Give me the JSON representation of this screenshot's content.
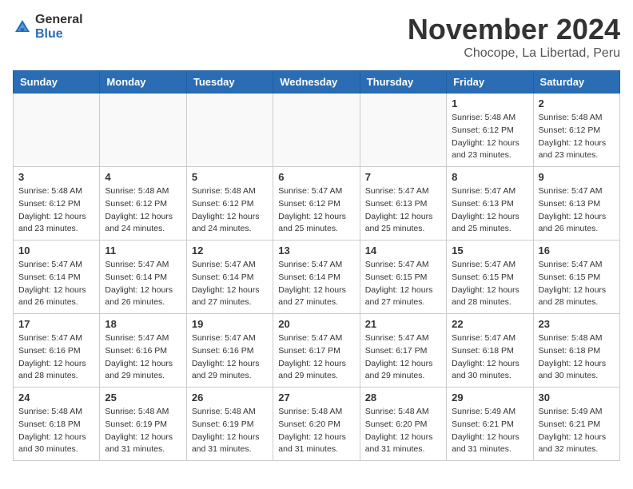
{
  "header": {
    "logo_general": "General",
    "logo_blue": "Blue",
    "title": "November 2024",
    "location": "Chocope, La Libertad, Peru"
  },
  "weekdays": [
    "Sunday",
    "Monday",
    "Tuesday",
    "Wednesday",
    "Thursday",
    "Friday",
    "Saturday"
  ],
  "weeks": [
    [
      {
        "day": "",
        "info": ""
      },
      {
        "day": "",
        "info": ""
      },
      {
        "day": "",
        "info": ""
      },
      {
        "day": "",
        "info": ""
      },
      {
        "day": "",
        "info": ""
      },
      {
        "day": "1",
        "info": "Sunrise: 5:48 AM\nSunset: 6:12 PM\nDaylight: 12 hours and 23 minutes."
      },
      {
        "day": "2",
        "info": "Sunrise: 5:48 AM\nSunset: 6:12 PM\nDaylight: 12 hours and 23 minutes."
      }
    ],
    [
      {
        "day": "3",
        "info": "Sunrise: 5:48 AM\nSunset: 6:12 PM\nDaylight: 12 hours and 23 minutes."
      },
      {
        "day": "4",
        "info": "Sunrise: 5:48 AM\nSunset: 6:12 PM\nDaylight: 12 hours and 24 minutes."
      },
      {
        "day": "5",
        "info": "Sunrise: 5:48 AM\nSunset: 6:12 PM\nDaylight: 12 hours and 24 minutes."
      },
      {
        "day": "6",
        "info": "Sunrise: 5:47 AM\nSunset: 6:12 PM\nDaylight: 12 hours and 25 minutes."
      },
      {
        "day": "7",
        "info": "Sunrise: 5:47 AM\nSunset: 6:13 PM\nDaylight: 12 hours and 25 minutes."
      },
      {
        "day": "8",
        "info": "Sunrise: 5:47 AM\nSunset: 6:13 PM\nDaylight: 12 hours and 25 minutes."
      },
      {
        "day": "9",
        "info": "Sunrise: 5:47 AM\nSunset: 6:13 PM\nDaylight: 12 hours and 26 minutes."
      }
    ],
    [
      {
        "day": "10",
        "info": "Sunrise: 5:47 AM\nSunset: 6:14 PM\nDaylight: 12 hours and 26 minutes."
      },
      {
        "day": "11",
        "info": "Sunrise: 5:47 AM\nSunset: 6:14 PM\nDaylight: 12 hours and 26 minutes."
      },
      {
        "day": "12",
        "info": "Sunrise: 5:47 AM\nSunset: 6:14 PM\nDaylight: 12 hours and 27 minutes."
      },
      {
        "day": "13",
        "info": "Sunrise: 5:47 AM\nSunset: 6:14 PM\nDaylight: 12 hours and 27 minutes."
      },
      {
        "day": "14",
        "info": "Sunrise: 5:47 AM\nSunset: 6:15 PM\nDaylight: 12 hours and 27 minutes."
      },
      {
        "day": "15",
        "info": "Sunrise: 5:47 AM\nSunset: 6:15 PM\nDaylight: 12 hours and 28 minutes."
      },
      {
        "day": "16",
        "info": "Sunrise: 5:47 AM\nSunset: 6:15 PM\nDaylight: 12 hours and 28 minutes."
      }
    ],
    [
      {
        "day": "17",
        "info": "Sunrise: 5:47 AM\nSunset: 6:16 PM\nDaylight: 12 hours and 28 minutes."
      },
      {
        "day": "18",
        "info": "Sunrise: 5:47 AM\nSunset: 6:16 PM\nDaylight: 12 hours and 29 minutes."
      },
      {
        "day": "19",
        "info": "Sunrise: 5:47 AM\nSunset: 6:16 PM\nDaylight: 12 hours and 29 minutes."
      },
      {
        "day": "20",
        "info": "Sunrise: 5:47 AM\nSunset: 6:17 PM\nDaylight: 12 hours and 29 minutes."
      },
      {
        "day": "21",
        "info": "Sunrise: 5:47 AM\nSunset: 6:17 PM\nDaylight: 12 hours and 29 minutes."
      },
      {
        "day": "22",
        "info": "Sunrise: 5:47 AM\nSunset: 6:18 PM\nDaylight: 12 hours and 30 minutes."
      },
      {
        "day": "23",
        "info": "Sunrise: 5:48 AM\nSunset: 6:18 PM\nDaylight: 12 hours and 30 minutes."
      }
    ],
    [
      {
        "day": "24",
        "info": "Sunrise: 5:48 AM\nSunset: 6:18 PM\nDaylight: 12 hours and 30 minutes."
      },
      {
        "day": "25",
        "info": "Sunrise: 5:48 AM\nSunset: 6:19 PM\nDaylight: 12 hours and 31 minutes."
      },
      {
        "day": "26",
        "info": "Sunrise: 5:48 AM\nSunset: 6:19 PM\nDaylight: 12 hours and 31 minutes."
      },
      {
        "day": "27",
        "info": "Sunrise: 5:48 AM\nSunset: 6:20 PM\nDaylight: 12 hours and 31 minutes."
      },
      {
        "day": "28",
        "info": "Sunrise: 5:48 AM\nSunset: 6:20 PM\nDaylight: 12 hours and 31 minutes."
      },
      {
        "day": "29",
        "info": "Sunrise: 5:49 AM\nSunset: 6:21 PM\nDaylight: 12 hours and 31 minutes."
      },
      {
        "day": "30",
        "info": "Sunrise: 5:49 AM\nSunset: 6:21 PM\nDaylight: 12 hours and 32 minutes."
      }
    ]
  ]
}
